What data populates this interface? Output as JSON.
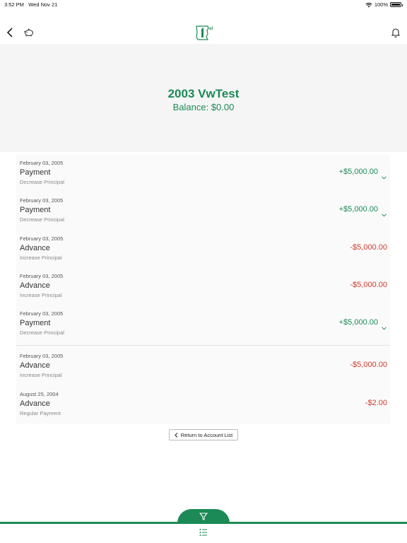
{
  "status_bar": {
    "time": "3:52 PM",
    "date": "Wed Nov 21",
    "battery": "100%",
    "battery_level": 1.0
  },
  "nav": {
    "back_icon": "chevron-left-icon",
    "piggy_icon": "piggy-bank-icon",
    "logo_icon": "first-logo-icon",
    "logo_text": "st",
    "bell_icon": "bell-icon"
  },
  "account": {
    "name": "2003 VwTest",
    "balance": "Balance: $0.00"
  },
  "transactions": [
    {
      "date": "February 03, 2005",
      "type": "Payment",
      "desc": "Decrease Principal",
      "amount": "+$5,000.00",
      "positive": true,
      "expandable": true
    },
    {
      "date": "February 03, 2005",
      "type": "Payment",
      "desc": "Decrease Principal",
      "amount": "+$5,000.00",
      "positive": true,
      "expandable": true
    },
    {
      "date": "February 03, 2005",
      "type": "Advance",
      "desc": "Increase Principal",
      "amount": "-$5,000.00",
      "positive": false,
      "expandable": false
    },
    {
      "date": "February 03, 2005",
      "type": "Advance",
      "desc": "Increase Principal",
      "amount": "-$5,000.00",
      "positive": false,
      "expandable": false
    },
    {
      "date": "February 03, 2005",
      "type": "Payment",
      "desc": "Decrease Principal",
      "amount": "+$5,000.00",
      "positive": true,
      "expandable": true
    },
    {
      "date": "February 03, 2005",
      "type": "Advance",
      "desc": "Increase Principal",
      "amount": "-$5,000.00",
      "positive": false,
      "expandable": false
    },
    {
      "date": "August 25, 2004",
      "type": "Advance",
      "desc": "Regular Payment",
      "amount": "-$2.00",
      "positive": false,
      "expandable": false
    }
  ],
  "return_button": {
    "label": "Return to Account List"
  },
  "bottom": {
    "filter_icon": "filter-icon",
    "list_icon": "list-icon"
  },
  "colors": {
    "brand_green": "#1b8a56",
    "negative_red": "#cf3a2b",
    "hero_bg": "#f5f5f5"
  }
}
